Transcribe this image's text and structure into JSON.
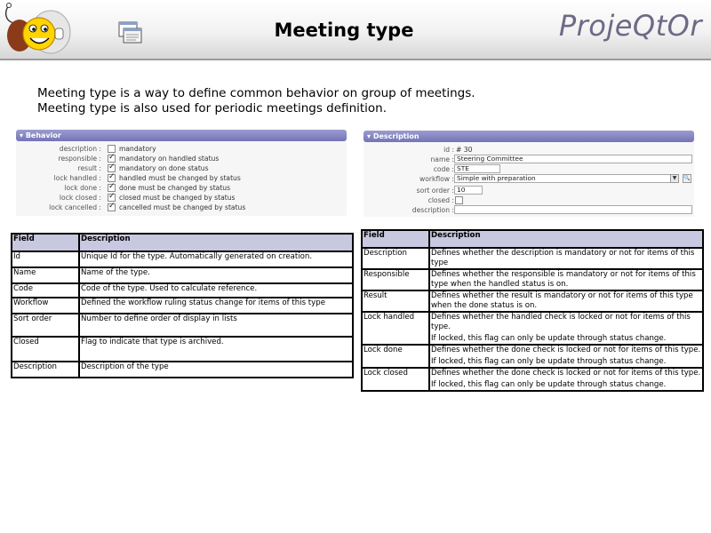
{
  "header": {
    "title": "Meeting type",
    "brand": "ProjeQtOr"
  },
  "intro": {
    "line1": "Meeting type is a way to define common behavior on group of meetings.",
    "line2": "Meeting type is also used for periodic meetings definition."
  },
  "behavior_panel": {
    "title": "Behavior",
    "rows": [
      {
        "label": "description :",
        "text": "mandatory",
        "checked": false
      },
      {
        "label": "responsible :",
        "text": "mandatory on handled status",
        "checked": true
      },
      {
        "label": "result :",
        "text": "mandatory on done status",
        "checked": true
      },
      {
        "label": "lock handled :",
        "text": "handled must be changed by status",
        "checked": true
      },
      {
        "label": "lock done :",
        "text": "done must be changed by status",
        "checked": true
      },
      {
        "label": "lock closed :",
        "text": "closed must be changed by status",
        "checked": true
      },
      {
        "label": "lock cancelled :",
        "text": "cancelled must be changed by status",
        "checked": true
      }
    ]
  },
  "description_panel": {
    "title": "Description",
    "id_label": "id :",
    "id_value": "# 30",
    "name_label": "name :",
    "name_value": "Steering Committee",
    "code_label": "code :",
    "code_value": "STE",
    "workflow_label": "workflow :",
    "workflow_value": "Simple with preparation",
    "sort_order_label": "sort order :",
    "sort_order_value": "10",
    "closed_label": "closed :",
    "closed_checked": false,
    "description_label": "description :",
    "description_value": ""
  },
  "left_table": {
    "headers": [
      "Field",
      "Description"
    ],
    "rows": [
      [
        "Id",
        "Unique Id for the type. Automatically generated on creation."
      ],
      [
        "Name",
        "Name of the type."
      ],
      [
        "Code",
        "Code of the type. Used to calculate reference."
      ],
      [
        "Workflow",
        "Defined the workflow ruling status change for items of this type"
      ],
      [
        "Sort order",
        "Number to define order of display in lists"
      ],
      [
        "Closed",
        "Flag to indicate that type is archived."
      ],
      [
        "Description",
        "Description of the type"
      ]
    ]
  },
  "right_table": {
    "headers": [
      "Field",
      "Description"
    ],
    "rows": [
      {
        "field": "Description",
        "desc": "Defines whether the description is mandatory or not for items of this type",
        "note": ""
      },
      {
        "field": "Responsible",
        "desc": "Defines whether the responsible is mandatory or not for items of this type when the handled status is on.",
        "note": ""
      },
      {
        "field": "Result",
        "desc": "Defines whether the result is mandatory or not for items of this type when the done status is on.",
        "note": ""
      },
      {
        "field": "Lock handled",
        "desc": "Defines whether the handled check is locked or not for items of this type.",
        "note": "If locked, this flag can only be update through status change."
      },
      {
        "field": "Lock done",
        "desc": "Defines whether the done check is locked or not for items of this type.",
        "note": "If locked, this flag can only be update through status change."
      },
      {
        "field": "Lock closed",
        "desc": "Defines whether the done check is locked or not for items of this type.",
        "note": "If locked, this flag can only be update through status change."
      }
    ]
  }
}
